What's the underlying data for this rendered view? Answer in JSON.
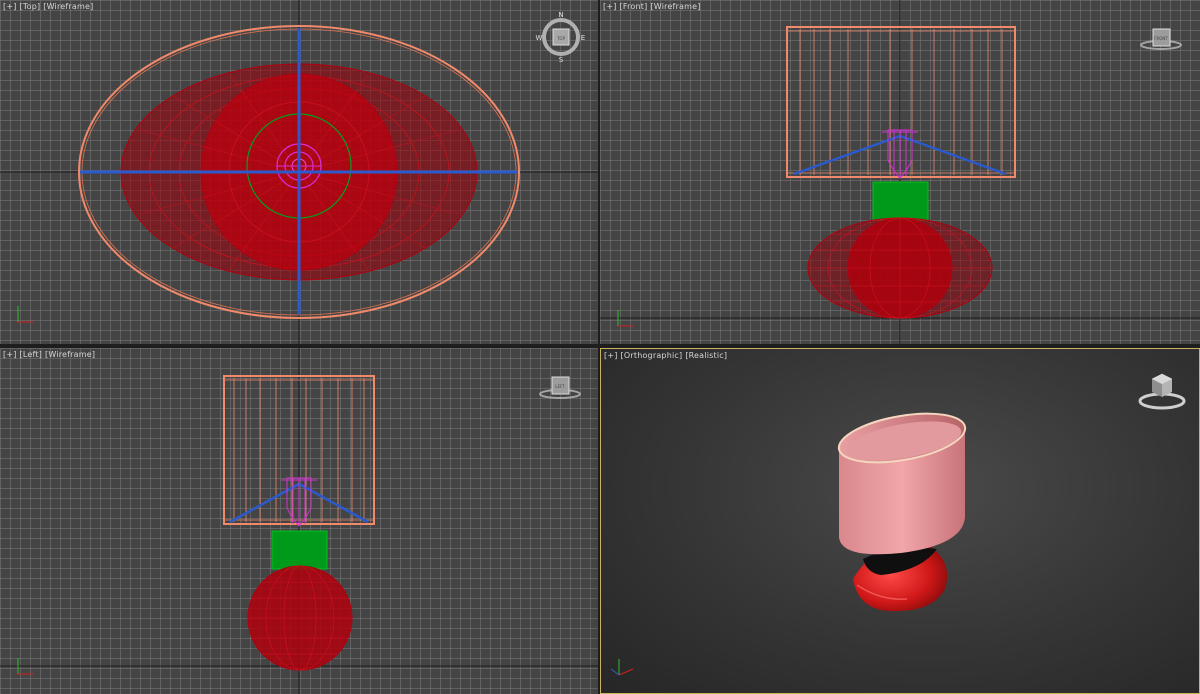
{
  "viewports": {
    "top": {
      "plus": "[+]",
      "view": "[Top]",
      "shading": "[Wireframe]"
    },
    "front": {
      "plus": "[+]",
      "view": "[Front]",
      "shading": "[Wireframe]"
    },
    "left": {
      "plus": "[+]",
      "view": "[Left]",
      "shading": "[Wireframe]"
    },
    "persp": {
      "plus": "[+]",
      "view": "[Orthographic]",
      "shading": "[Realistic]"
    }
  },
  "viewcube": {
    "north": "N",
    "south": "S",
    "east": "E",
    "west": "W",
    "top_face": "TOP",
    "front_face": "FRONT",
    "left_face": "LEFT"
  },
  "colors": {
    "shade_wire": "#f08a6a",
    "bulb_base": "#d42fd4",
    "lamp_neck": "#009a1a",
    "lamp_body_wire": "#b00010",
    "support_arms": "#2a5acb",
    "grid": "#787878",
    "active_border": "#c8b45a"
  }
}
